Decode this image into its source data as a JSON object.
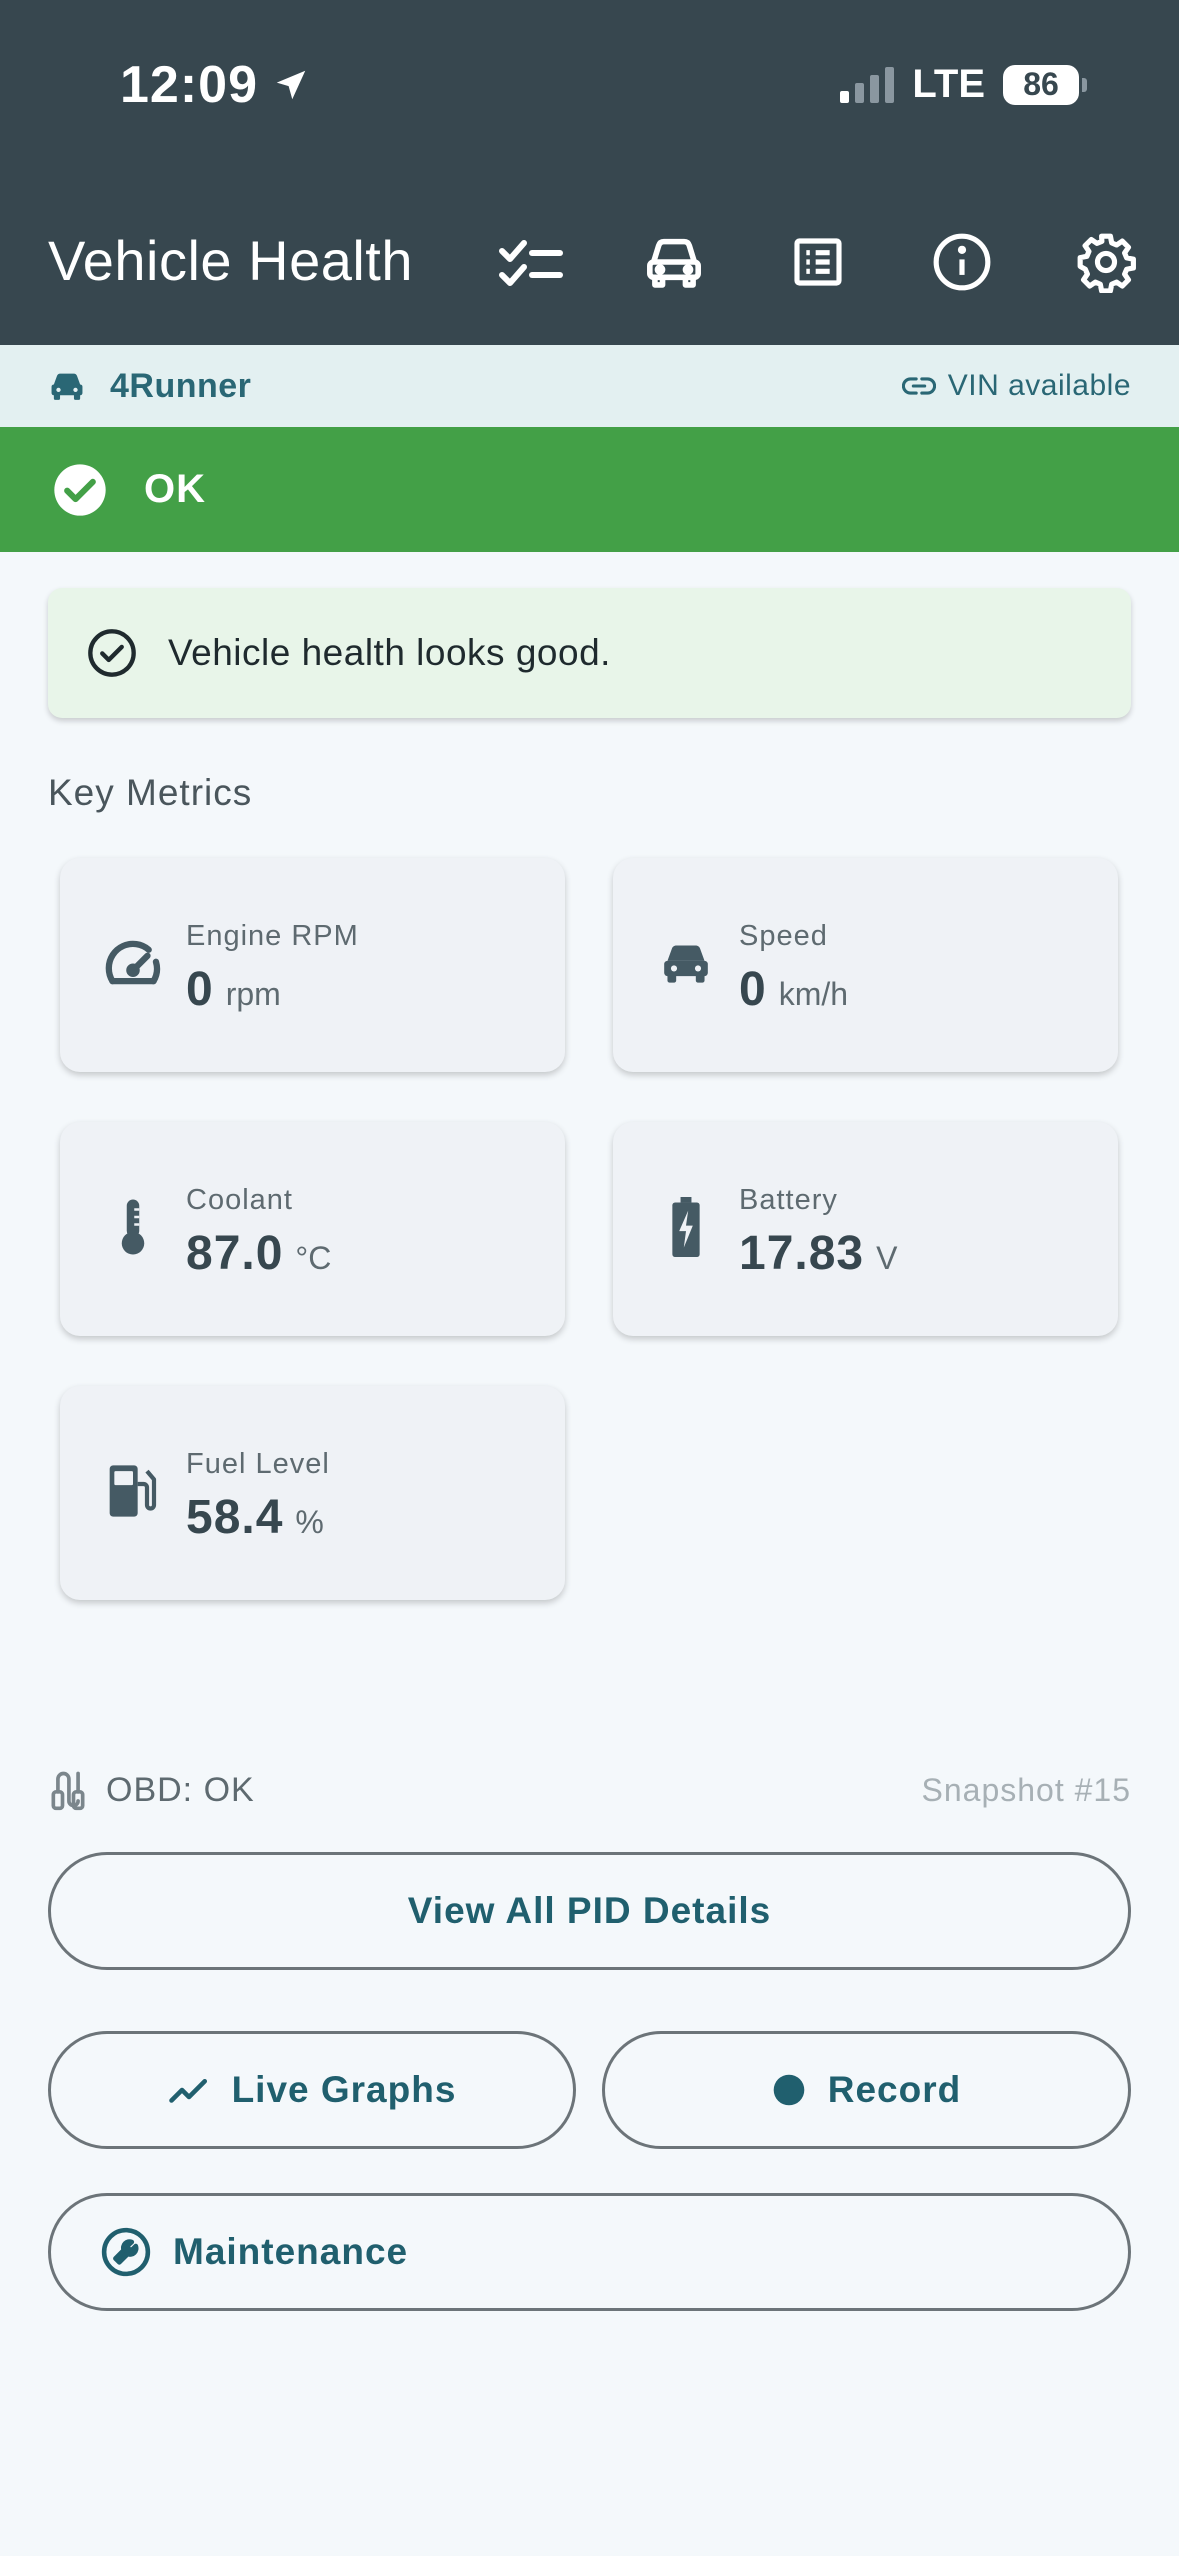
{
  "status_bar": {
    "time": "12:09",
    "network": "LTE",
    "battery": "86"
  },
  "header": {
    "title": "Vehicle Health",
    "icons": [
      "checklist-icon",
      "car-icon",
      "list-icon",
      "info-icon",
      "settings-icon"
    ]
  },
  "vehicle": {
    "name": "4Runner",
    "vin_status": "VIN available"
  },
  "status": {
    "label": "OK",
    "color": "#43a047"
  },
  "health_message": "Vehicle health looks good.",
  "key_metrics": {
    "title": "Key Metrics",
    "items": [
      {
        "label": "Engine RPM",
        "value": "0",
        "unit": "rpm",
        "icon": "speedometer-icon"
      },
      {
        "label": "Speed",
        "value": "0",
        "unit": "km/h",
        "icon": "car-icon"
      },
      {
        "label": "Coolant",
        "value": "87.0",
        "unit": "°C",
        "icon": "thermometer-icon"
      },
      {
        "label": "Battery",
        "value": "17.83",
        "unit": "V",
        "icon": "battery-charging-icon"
      },
      {
        "label": "Fuel Level",
        "value": "58.4",
        "unit": "%",
        "icon": "fuel-pump-icon"
      }
    ]
  },
  "obd": {
    "status": "OBD: OK",
    "snapshot": "Snapshot #15"
  },
  "buttons": {
    "view_all": "View All PID Details",
    "live_graphs": "Live Graphs",
    "record": "Record",
    "maintenance": "Maintenance"
  },
  "colors": {
    "header_bg": "#37474f",
    "accent": "#205f6e",
    "success": "#43a047",
    "health_card_bg": "#e8f5e9"
  }
}
